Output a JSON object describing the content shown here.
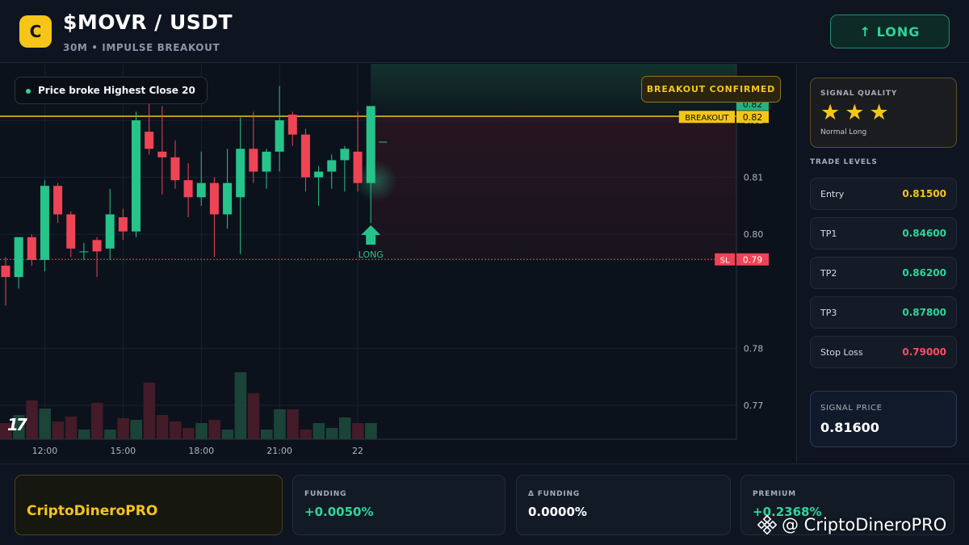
{
  "header": {
    "logo_letter": "C",
    "pair": "$MOVR / USDT",
    "subtitle": "30M • IMPULSE BREAKOUT",
    "direction_button": "↑ LONG"
  },
  "chart": {
    "signal_pill": "Price broke Highest Close 20",
    "confirm_badge": "BREAKOUT CONFIRMED",
    "signal_marker_label": "LONG",
    "breakout_tag": "BREAKOUT",
    "sl_tag": "SL",
    "logo_text": "17"
  },
  "chart_data": {
    "type": "candlestick",
    "y_ticks": [
      0.82,
      0.81,
      0.8,
      0.78,
      0.77
    ],
    "ylim": [
      0.765,
      0.829
    ],
    "x_ticks": [
      {
        "label": "12:00",
        "index": 3
      },
      {
        "label": "15:00",
        "index": 9
      },
      {
        "label": "18:00",
        "index": 15
      },
      {
        "label": "21:00",
        "index": 21
      },
      {
        "label": "22",
        "index": 27
      }
    ],
    "price_labels": [
      {
        "value": "0.82",
        "price": 0.8228,
        "color": "#26b37e",
        "tag": ""
      },
      {
        "value": "0.82",
        "price": 0.8206,
        "color": "#f5c518",
        "tag": "BREAKOUT"
      },
      {
        "value": "0.79",
        "price": 0.7956,
        "color": "#ef4455",
        "tag": "SL"
      }
    ],
    "breakout_level": 0.8207,
    "stop_level": 0.7956,
    "candles": [
      {
        "o": 0.7945,
        "h": 0.796,
        "l": 0.7875,
        "c": 0.7925
      },
      {
        "o": 0.7925,
        "h": 0.7985,
        "l": 0.7905,
        "c": 0.7995
      },
      {
        "o": 0.7995,
        "h": 0.8,
        "l": 0.7945,
        "c": 0.7955
      },
      {
        "o": 0.7955,
        "h": 0.8095,
        "l": 0.7935,
        "c": 0.8085
      },
      {
        "o": 0.8085,
        "h": 0.809,
        "l": 0.802,
        "c": 0.8035
      },
      {
        "o": 0.8035,
        "h": 0.804,
        "l": 0.796,
        "c": 0.7975
      },
      {
        "o": 0.797,
        "h": 0.7985,
        "l": 0.7955,
        "c": 0.797
      },
      {
        "o": 0.799,
        "h": 0.7995,
        "l": 0.7925,
        "c": 0.797
      },
      {
        "o": 0.7975,
        "h": 0.808,
        "l": 0.7955,
        "c": 0.8035
      },
      {
        "o": 0.803,
        "h": 0.8045,
        "l": 0.799,
        "c": 0.8005
      },
      {
        "o": 0.8005,
        "h": 0.8215,
        "l": 0.7995,
        "c": 0.82
      },
      {
        "o": 0.818,
        "h": 0.823,
        "l": 0.814,
        "c": 0.815
      },
      {
        "o": 0.8145,
        "h": 0.8225,
        "l": 0.807,
        "c": 0.8135
      },
      {
        "o": 0.8135,
        "h": 0.8165,
        "l": 0.808,
        "c": 0.8095
      },
      {
        "o": 0.8095,
        "h": 0.8125,
        "l": 0.803,
        "c": 0.8065
      },
      {
        "o": 0.8065,
        "h": 0.8145,
        "l": 0.805,
        "c": 0.809
      },
      {
        "o": 0.809,
        "h": 0.81,
        "l": 0.796,
        "c": 0.8035
      },
      {
        "o": 0.8035,
        "h": 0.815,
        "l": 0.801,
        "c": 0.809
      },
      {
        "o": 0.8065,
        "h": 0.8205,
        "l": 0.7965,
        "c": 0.815
      },
      {
        "o": 0.815,
        "h": 0.8215,
        "l": 0.809,
        "c": 0.811
      },
      {
        "o": 0.811,
        "h": 0.815,
        "l": 0.808,
        "c": 0.8145
      },
      {
        "o": 0.8145,
        "h": 0.826,
        "l": 0.811,
        "c": 0.82
      },
      {
        "o": 0.821,
        "h": 0.8215,
        "l": 0.8155,
        "c": 0.8175
      },
      {
        "o": 0.8175,
        "h": 0.8185,
        "l": 0.8075,
        "c": 0.81
      },
      {
        "o": 0.81,
        "h": 0.812,
        "l": 0.805,
        "c": 0.811
      },
      {
        "o": 0.811,
        "h": 0.814,
        "l": 0.808,
        "c": 0.813
      },
      {
        "o": 0.813,
        "h": 0.8155,
        "l": 0.8075,
        "c": 0.815
      },
      {
        "o": 0.8145,
        "h": 0.8215,
        "l": 0.8075,
        "c": 0.809
      },
      {
        "o": 0.809,
        "h": 0.822,
        "l": 0.802,
        "c": 0.8225
      }
    ],
    "volumes": [
      20,
      30,
      48,
      38,
      22,
      28,
      12,
      45,
      12,
      26,
      24,
      70,
      30,
      22,
      14,
      20,
      24,
      12,
      83,
      57,
      12,
      37,
      37,
      12,
      20,
      14,
      27,
      20,
      20
    ]
  },
  "signal_quality": {
    "label": "SIGNAL QUALITY",
    "stars": [
      "★",
      "★",
      "★"
    ],
    "rating": 3,
    "note": "Normal Long"
  },
  "trade_levels": {
    "label": "TRADE LEVELS",
    "items": [
      {
        "name": "Entry",
        "value": "0.81500",
        "color": "#f5c518"
      },
      {
        "name": "TP1",
        "value": "0.84600",
        "color": "#2ed598"
      },
      {
        "name": "TP2",
        "value": "0.86200",
        "color": "#2ed598"
      },
      {
        "name": "TP3",
        "value": "0.87800",
        "color": "#2ed598"
      },
      {
        "name": "Stop Loss",
        "value": "0.79000",
        "color": "#ff4d63"
      }
    ]
  },
  "signal_price": {
    "label": "SIGNAL PRICE",
    "value": "0.81600"
  },
  "footer": {
    "brand": "CriptoDineroPRO",
    "stats": [
      {
        "label": "FUNDING",
        "value": "+0.0050%",
        "color": "#2ed598"
      },
      {
        "label": "Δ FUNDING",
        "value": "0.0000%",
        "color": "#ffffff"
      },
      {
        "label": "PREMIUM",
        "value": "+0.2368%",
        "color": "#2ed598"
      }
    ],
    "watermark": "@ CriptoDineroPRO"
  },
  "colors": {
    "up": "#26c48a",
    "down": "#ef4455",
    "accent": "#f5c518"
  }
}
